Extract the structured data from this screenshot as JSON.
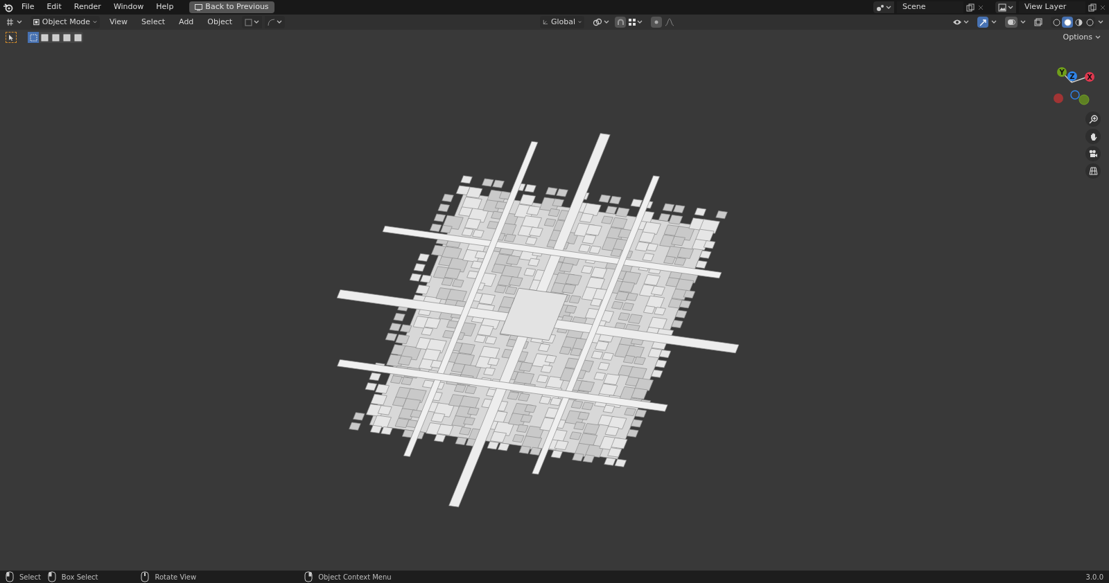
{
  "menu": [
    "File",
    "Edit",
    "Render",
    "Window",
    "Help"
  ],
  "back_button": "Back to Previous",
  "scene": {
    "value": "Scene"
  },
  "view_layer": {
    "value": "View Layer"
  },
  "header": {
    "mode": "Object Mode",
    "menus": [
      "View",
      "Select",
      "Add",
      "Object"
    ],
    "orientation": "Global"
  },
  "select_modes": [
    {
      "selected": true
    },
    {
      "selected": false
    },
    {
      "selected": false
    },
    {
      "selected": false
    },
    {
      "selected": false
    }
  ],
  "shading_modes": [
    {
      "selected": false
    },
    {
      "selected": true
    },
    {
      "selected": false
    },
    {
      "selected": false
    }
  ],
  "overlay_toggle": {
    "on": true
  },
  "options": "Options",
  "gizmo": {
    "axes": [
      {
        "label": "Y",
        "color": "#6f9e1a"
      },
      {
        "label": "Z",
        "color": "#2f83e6"
      },
      {
        "label": "X",
        "color": "#e0384f"
      }
    ]
  },
  "status_bar": {
    "hints": [
      {
        "kind": "left",
        "label": "Select"
      },
      {
        "kind": "drag",
        "label": "Box Select"
      },
      {
        "kind": "middle",
        "label": "Rotate View"
      },
      {
        "kind": "right",
        "label": "Object Context Menu"
      }
    ],
    "version": "3.0.0"
  }
}
